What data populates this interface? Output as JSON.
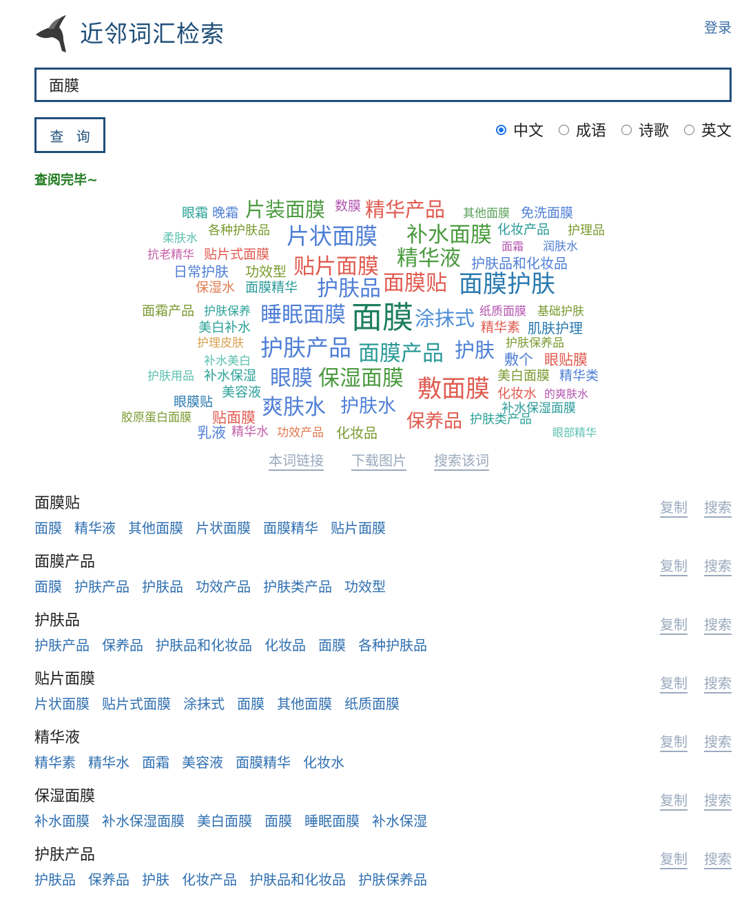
{
  "header": {
    "title": "近邻词汇检索",
    "login_label": "登录",
    "logo_icon": "magpie-bird-icon"
  },
  "search": {
    "value": "面膜",
    "button_label": "查 询"
  },
  "modes": [
    {
      "label": "中文",
      "checked": true
    },
    {
      "label": "成语",
      "checked": false
    },
    {
      "label": "诗歌",
      "checked": false
    },
    {
      "label": "英文",
      "checked": false
    }
  ],
  "status": "查阅完毕~",
  "wordcloud": {
    "words": [
      {
        "text": "眼霜",
        "size": 19,
        "color": "#2aa198"
      },
      {
        "text": "晚霜",
        "size": 19,
        "color": "#4f7fd6"
      },
      {
        "text": "片装面膜",
        "size": 29,
        "color": "#4a9a3e"
      },
      {
        "text": "数膜",
        "size": 19,
        "color": "#b455b0"
      },
      {
        "text": "精华产品",
        "size": 29,
        "color": "#e05a4f"
      },
      {
        "text": "其他面膜",
        "size": 17,
        "color": "#5aa05a"
      },
      {
        "text": "免洗面膜",
        "size": 19,
        "color": "#4f7fd6"
      },
      {
        "text": "柔肤水",
        "size": 17,
        "color": "#5cc0b0"
      },
      {
        "text": "各种护肤品",
        "size": 18,
        "color": "#7a9a30"
      },
      {
        "text": "片状面膜",
        "size": 33,
        "color": "#4f7fd6"
      },
      {
        "text": "补水面膜",
        "size": 31,
        "color": "#4a9a3e"
      },
      {
        "text": "化妆产品",
        "size": 19,
        "color": "#2a9a98"
      },
      {
        "text": "护理品",
        "size": 18,
        "color": "#7a9a30"
      },
      {
        "text": "面霜",
        "size": 16,
        "color": "#b455b0"
      },
      {
        "text": "润肤水",
        "size": 17,
        "color": "#4f7fd6"
      },
      {
        "text": "抗老精华",
        "size": 17,
        "color": "#c55fa6"
      },
      {
        "text": "贴片式面膜",
        "size": 19,
        "color": "#e05a4f"
      },
      {
        "text": "日常护肤",
        "size": 20,
        "color": "#4f7fd6"
      },
      {
        "text": "功效型",
        "size": 20,
        "color": "#7a9a30"
      },
      {
        "text": "贴片面膜",
        "size": 31,
        "color": "#e05a4f"
      },
      {
        "text": "精华液",
        "size": 31,
        "color": "#4a9a3e"
      },
      {
        "text": "护肤品和化妆品",
        "size": 20,
        "color": "#4f7fd6"
      },
      {
        "text": "保湿水",
        "size": 19,
        "color": "#e07a4f"
      },
      {
        "text": "面膜精华",
        "size": 19,
        "color": "#2a9a98"
      },
      {
        "text": "护肤品",
        "size": 31,
        "color": "#4f7fd6"
      },
      {
        "text": "面膜贴",
        "size": 31,
        "color": "#e05a4f"
      },
      {
        "text": "面膜护肤",
        "size": 35,
        "color": "#2a7ab0"
      },
      {
        "text": "面霜产品",
        "size": 19,
        "color": "#7a9a30"
      },
      {
        "text": "护肤保养",
        "size": 17,
        "color": "#2aa198"
      },
      {
        "text": "睡眠面膜",
        "size": 31,
        "color": "#4f7fd6"
      },
      {
        "text": "面膜",
        "size": 45,
        "color": "#1e7f5c"
      },
      {
        "text": "涂抹式",
        "size": 29,
        "color": "#4f8fd6"
      },
      {
        "text": "纸质面膜",
        "size": 17,
        "color": "#b455b0"
      },
      {
        "text": "基础护肤",
        "size": 17,
        "color": "#7a9a30"
      },
      {
        "text": "美白补水",
        "size": 19,
        "color": "#2aa198"
      },
      {
        "text": "精华素",
        "size": 19,
        "color": "#e05a4f"
      },
      {
        "text": "肌肤护理",
        "size": 20,
        "color": "#2a7ab0"
      },
      {
        "text": "护理皮肤",
        "size": 17,
        "color": "#d9a050"
      },
      {
        "text": "护肤产品",
        "size": 33,
        "color": "#4f7fd6"
      },
      {
        "text": "面膜产品",
        "size": 31,
        "color": "#2a9a98"
      },
      {
        "text": "护肤",
        "size": 29,
        "color": "#4f7fd6"
      },
      {
        "text": "护肤保养品",
        "size": 17,
        "color": "#7a9a30"
      },
      {
        "text": "补水美白",
        "size": 17,
        "color": "#5cc0b0"
      },
      {
        "text": "敷个",
        "size": 21,
        "color": "#4f7fd6"
      },
      {
        "text": "眼贴膜",
        "size": 21,
        "color": "#e05a4f"
      },
      {
        "text": "护肤用品",
        "size": 17,
        "color": "#5cc0b0"
      },
      {
        "text": "补水保湿",
        "size": 19,
        "color": "#2aa198"
      },
      {
        "text": "眼膜",
        "size": 31,
        "color": "#4f7fd6"
      },
      {
        "text": "保湿面膜",
        "size": 31,
        "color": "#4a9a3e"
      },
      {
        "text": "美白面膜",
        "size": 19,
        "color": "#7a9a30"
      },
      {
        "text": "精华类",
        "size": 19,
        "color": "#4f7fd6"
      },
      {
        "text": "美容液",
        "size": 19,
        "color": "#2aa198"
      },
      {
        "text": "敷面膜",
        "size": 35,
        "color": "#e05a4f"
      },
      {
        "text": "化妆水",
        "size": 19,
        "color": "#e05a4f"
      },
      {
        "text": "的爽肤水",
        "size": 16,
        "color": "#b455b0"
      },
      {
        "text": "眼膜贴",
        "size": 19,
        "color": "#2a7ab0"
      },
      {
        "text": "爽肤水",
        "size": 31,
        "color": "#4f7fd6"
      },
      {
        "text": "护肤水",
        "size": 27,
        "color": "#4f7fd6"
      },
      {
        "text": "补水保湿面膜",
        "size": 18,
        "color": "#2a9a98"
      },
      {
        "text": "胶原蛋白面膜",
        "size": 17,
        "color": "#7a9a30"
      },
      {
        "text": "贴面膜",
        "size": 21,
        "color": "#e05a4f"
      },
      {
        "text": "保养品",
        "size": 27,
        "color": "#e05a4f"
      },
      {
        "text": "护肤类产品",
        "size": 18,
        "color": "#2aa198"
      },
      {
        "text": "乳液",
        "size": 21,
        "color": "#4f7fd6"
      },
      {
        "text": "精华水",
        "size": 18,
        "color": "#c55fa6"
      },
      {
        "text": "功效产品",
        "size": 17,
        "color": "#e07a4f"
      },
      {
        "text": "化妆品",
        "size": 20,
        "color": "#7a9a30"
      },
      {
        "text": "眼部精华",
        "size": 16,
        "color": "#5cc0b0"
      }
    ]
  },
  "cloud_actions": [
    "本词链接",
    "下载图片",
    "搜索该词"
  ],
  "row_actions": {
    "copy": "复制",
    "search": "搜索"
  },
  "results": [
    {
      "word": "面膜贴",
      "related": [
        "面膜",
        "精华液",
        "其他面膜",
        "片状面膜",
        "面膜精华",
        "贴片面膜"
      ]
    },
    {
      "word": "面膜产品",
      "related": [
        "面膜",
        "护肤产品",
        "护肤品",
        "功效产品",
        "护肤类产品",
        "功效型"
      ]
    },
    {
      "word": "护肤品",
      "related": [
        "护肤产品",
        "保养品",
        "护肤品和化妆品",
        "化妆品",
        "面膜",
        "各种护肤品"
      ]
    },
    {
      "word": "贴片面膜",
      "related": [
        "片状面膜",
        "贴片式面膜",
        "涂抹式",
        "面膜",
        "其他面膜",
        "纸质面膜"
      ]
    },
    {
      "word": "精华液",
      "related": [
        "精华素",
        "精华水",
        "面霜",
        "美容液",
        "面膜精华",
        "化妆水"
      ]
    },
    {
      "word": "保湿面膜",
      "related": [
        "补水面膜",
        "补水保湿面膜",
        "美白面膜",
        "面膜",
        "睡眠面膜",
        "补水保湿"
      ]
    },
    {
      "word": "护肤产品",
      "related": [
        "护肤品",
        "保养品",
        "护肤",
        "化妆产品",
        "护肤品和化妆品",
        "护肤保养品"
      ]
    }
  ]
}
